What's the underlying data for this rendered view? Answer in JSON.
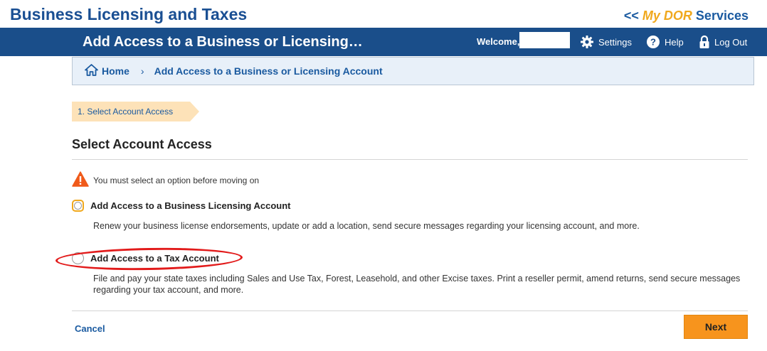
{
  "header": {
    "app_title": "Business Licensing and Taxes",
    "mydor_prefix": "<< ",
    "mydor_my": "My DOR",
    "mydor_suffix": " Services"
  },
  "navbar": {
    "page_heading": "Add Access to a Business or Licensing…",
    "welcome_label": "Welcome,",
    "settings_label": "Settings",
    "help_label": "Help",
    "logout_label": "Log Out"
  },
  "breadcrumb": {
    "home_label": "Home",
    "separator": "›",
    "current_label": "Add Access to a Business or Licensing Account"
  },
  "steps": [
    {
      "label": "1. Select Account Access",
      "active": true
    }
  ],
  "section_title": "Select Account Access",
  "warning_text": "You must select an option before moving on",
  "options": [
    {
      "label": "Add Access to a Business Licensing Account",
      "description": "Renew your business license endorsements, update or add a location, send secure messages regarding your licensing account, and more.",
      "selected": false,
      "focused": true
    },
    {
      "label": "Add Access to a Tax Account",
      "description": "File and pay your state taxes including Sales and Use Tax, Forest, Leasehold, and other Excise taxes. Print a reseller permit, amend returns, send secure messages regarding your tax account, and more.",
      "selected": false,
      "focused": false
    }
  ],
  "actions": {
    "cancel_label": "Cancel",
    "next_label": "Next"
  },
  "colors": {
    "navbar": "#1a4e8a",
    "accent": "#f7941d",
    "link": "#1a5aa0",
    "annotation": "#e21b1b"
  },
  "icons": [
    "home-icon",
    "gear-icon",
    "help-icon",
    "lock-icon",
    "warning-icon"
  ]
}
